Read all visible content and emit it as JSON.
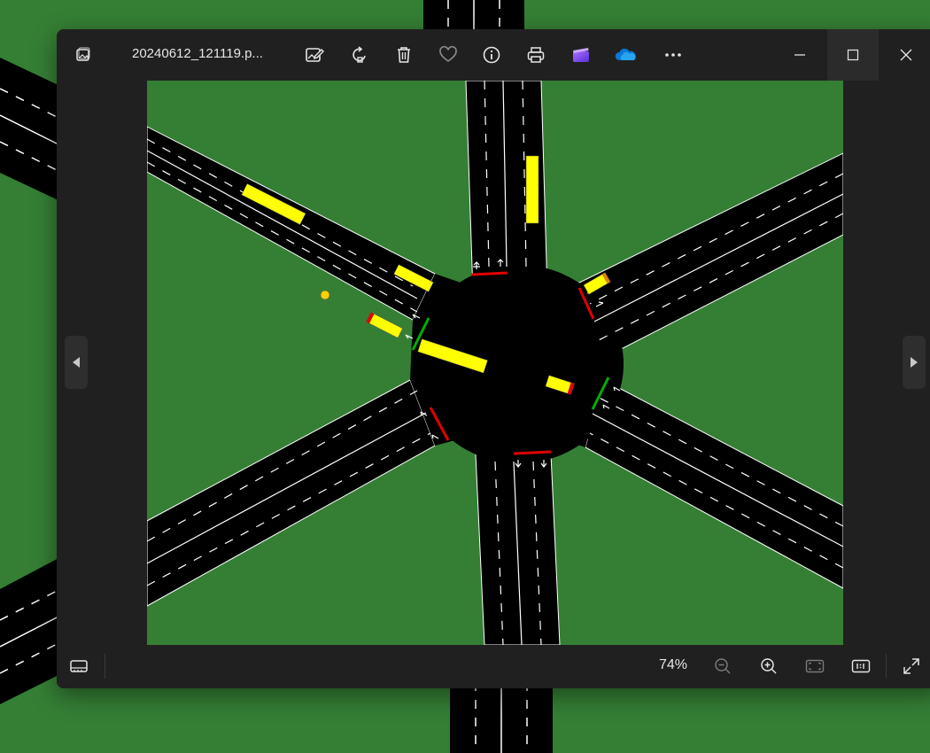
{
  "window": {
    "file_name": "20240612_121119.p...",
    "zoom_level": "74%"
  },
  "toolbar": {
    "items": [
      "edit-image",
      "rotate",
      "delete",
      "favorite",
      "file-info",
      "print",
      "clipchamp",
      "onedrive",
      "see-more"
    ]
  },
  "colors": {
    "grass": "#357f35",
    "road": "#000000",
    "vehicle": "#ffff00",
    "signal_red": "#e00000",
    "signal_green": "#00b000",
    "chrome": "#202020",
    "text": "#e6e6e6"
  },
  "scene": {
    "signals": [
      "red",
      "green",
      "red",
      "green",
      "red",
      "red"
    ]
  }
}
